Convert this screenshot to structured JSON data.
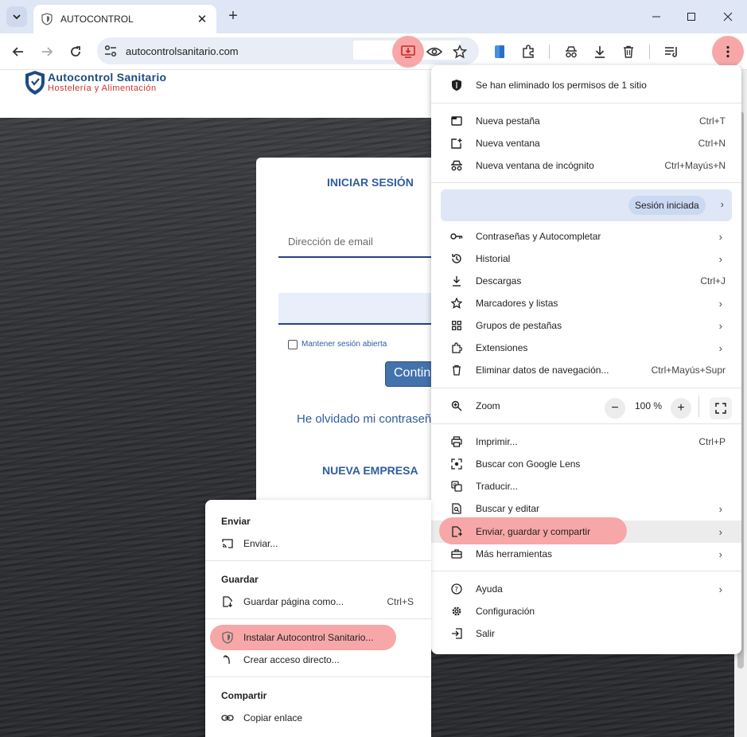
{
  "tab": {
    "title": "AUTOCONTROL"
  },
  "omnibox": {
    "url": "autocontrolsanitario.com"
  },
  "page": {
    "logo_title": "Autocontrol Sanitario",
    "logo_subtitle": "Hostelería y Alimentación",
    "login_title": "INICIAR SESIÓN",
    "email_placeholder": "Dirección de email",
    "keep_session": "Mantener sesión abierta",
    "continue_button": "Contin",
    "forgot_password": "He olvidado mi contraseñ",
    "new_company": "NUEVA EMPRESA"
  },
  "menu": {
    "permissions_notice": "Se han eliminado los permisos de 1 sitio",
    "new_tab": {
      "label": "Nueva pestaña",
      "shortcut": "Ctrl+T"
    },
    "new_window": {
      "label": "Nueva ventana",
      "shortcut": "Ctrl+N"
    },
    "incognito": {
      "label": "Nueva ventana de incógnito",
      "shortcut": "Ctrl+Mayús+N"
    },
    "session": "Sesión iniciada",
    "passwords": "Contraseñas y Autocompletar",
    "history": "Historial",
    "downloads": {
      "label": "Descargas",
      "shortcut": "Ctrl+J"
    },
    "bookmarks": "Marcadores y listas",
    "tab_groups": "Grupos de pestañas",
    "extensions": "Extensiones",
    "clear_data": {
      "label": "Eliminar datos de navegación...",
      "shortcut": "Ctrl+Mayús+Supr"
    },
    "zoom": {
      "label": "Zoom",
      "value": "100 %",
      "minus": "−",
      "plus": "+"
    },
    "print": {
      "label": "Imprimir...",
      "shortcut": "Ctrl+P"
    },
    "lens": "Buscar con Google Lens",
    "translate": "Traducir...",
    "find_edit": "Buscar y editar",
    "send_save_share": "Enviar, guardar y compartir",
    "more_tools": "Más herramientas",
    "help": "Ayuda",
    "settings": "Configuración",
    "exit": "Salir"
  },
  "submenu": {
    "send_header": "Enviar",
    "cast": "Enviar...",
    "save_header": "Guardar",
    "save_page": {
      "label": "Guardar página como...",
      "shortcut": "Ctrl+S"
    },
    "install": "Instalar Autocontrol Sanitario...",
    "shortcut": "Crear acceso directo...",
    "share_header": "Compartir",
    "copy_link": "Copiar enlace"
  },
  "colors": {
    "highlight": "#f7a7a7",
    "brand_blue": "#1d4b82",
    "brand_red": "#d1332b",
    "menu_hover": "#ececec"
  }
}
